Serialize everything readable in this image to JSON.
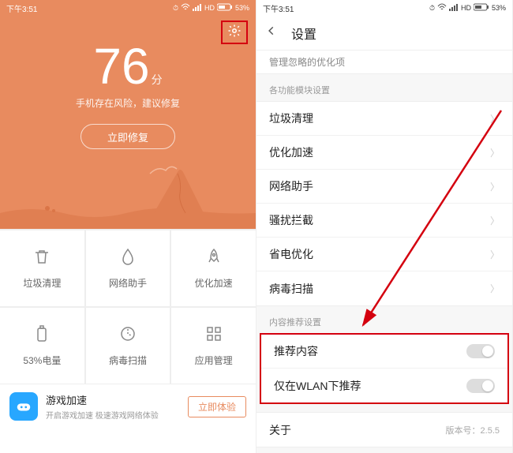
{
  "status": {
    "time": "下午3:51",
    "hd": "HD",
    "battery": "53%"
  },
  "left": {
    "score": "76",
    "score_unit": "分",
    "score_sub": "手机存在风险，建议修复",
    "fix_btn": "立即修复",
    "grid": [
      {
        "icon": "trash",
        "label": "垃圾清理"
      },
      {
        "icon": "drop",
        "label": "网络助手"
      },
      {
        "icon": "rocket",
        "label": "优化加速"
      },
      {
        "icon": "battery",
        "label": "53%电量"
      },
      {
        "icon": "scan",
        "label": "病毒扫描"
      },
      {
        "icon": "apps",
        "label": "应用管理"
      }
    ],
    "promo": {
      "title": "游戏加速",
      "sub": "开启游戏加速 极速游戏网络体验",
      "btn": "立即体验"
    }
  },
  "right": {
    "title": "设置",
    "truncated": "管理忽略的优化项",
    "section1_title": "各功能模块设置",
    "items1": [
      "垃圾清理",
      "优化加速",
      "网络助手",
      "骚扰拦截",
      "省电优化",
      "病毒扫描"
    ],
    "section2_title": "内容推荐设置",
    "toggle1": "推荐内容",
    "toggle2": "仅在WLAN下推荐",
    "about": "关于",
    "version_label": "版本号：",
    "version": "2.5.5"
  }
}
